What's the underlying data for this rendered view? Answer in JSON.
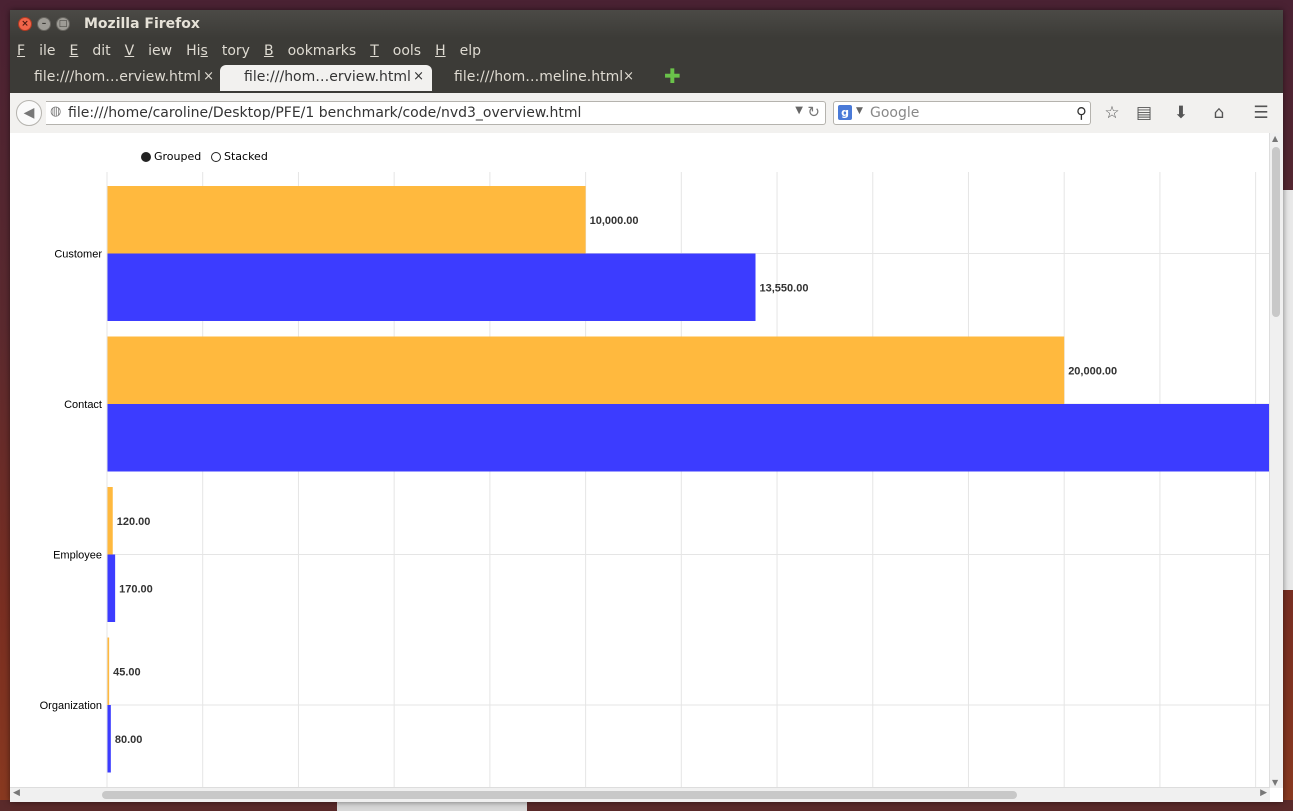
{
  "window": {
    "title": "Mozilla Firefox"
  },
  "menu": [
    {
      "label": "File",
      "u": "F",
      "rest": "ile"
    },
    {
      "label": "Edit",
      "u": "E",
      "rest": "dit"
    },
    {
      "label": "View",
      "u": "V",
      "rest": "iew"
    },
    {
      "label": "History",
      "pre": "Hi",
      "u": "s",
      "rest": "tory"
    },
    {
      "label": "Bookmarks",
      "u": "B",
      "rest": "ookmarks"
    },
    {
      "label": "Tools",
      "u": "T",
      "rest": "ools"
    },
    {
      "label": "Help",
      "u": "H",
      "rest": "elp"
    }
  ],
  "tabs": [
    {
      "label": "file:///hom…erview.html",
      "active": false
    },
    {
      "label": "file:///hom…erview.html",
      "active": true
    },
    {
      "label": "file:///hom…meline.html",
      "active": false
    }
  ],
  "tab_close_glyph": "×",
  "nav": {
    "url": "file:///home/caroline/Desktop/PFE/1 benchmark/code/nvd3_overview.html",
    "search_placeholder": "Google"
  },
  "chart_data": {
    "type": "bar",
    "orientation": "horizontal",
    "controls": [
      "Grouped",
      "Stacked"
    ],
    "selected_control": "Grouped",
    "categories": [
      "Customer",
      "Contact",
      "Employee",
      "Organization"
    ],
    "series": [
      {
        "color": "#ffb93e",
        "values": [
          10000,
          20000,
          120,
          45
        ],
        "labels": [
          "10,000.00",
          "20,000.00",
          "120.00",
          "45.00"
        ]
      },
      {
        "color": "#3c3cff",
        "values": [
          13550,
          24300,
          170,
          80
        ],
        "labels": [
          "13,550.00",
          "",
          "170.00",
          "80.00"
        ]
      }
    ],
    "xlim": [
      0,
      24300
    ],
    "grid": true
  },
  "colors": {
    "titlebar": "#3c3b37",
    "accent_close": "#f0654a",
    "newtab": "#6ac24a"
  }
}
